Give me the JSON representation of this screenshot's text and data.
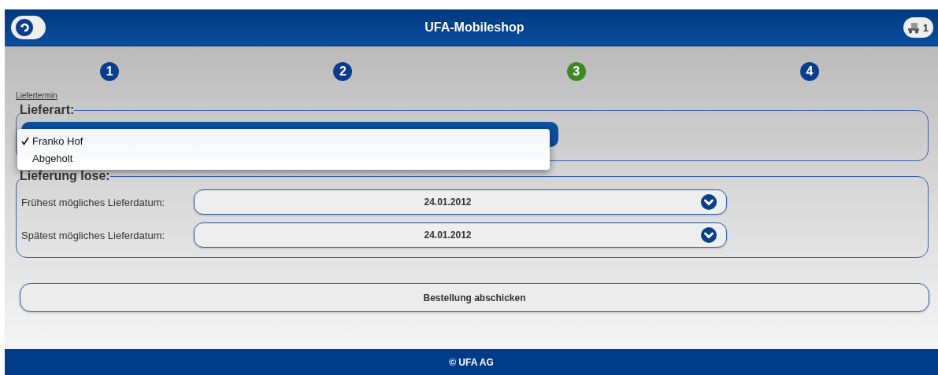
{
  "header": {
    "title": "UFA-Mobileshop",
    "cart_count": "1"
  },
  "steps": [
    {
      "label": "1",
      "selected": false
    },
    {
      "label": "2",
      "selected": false
    },
    {
      "label": "3",
      "selected": true
    },
    {
      "label": "4",
      "selected": false
    }
  ],
  "breadcrumb": "Liefertermin",
  "lieferart": {
    "legend": "Lieferart:",
    "menu": [
      {
        "label": "Franko Hof",
        "checked": true
      },
      {
        "label": "Abgeholt",
        "checked": false
      }
    ]
  },
  "lieferung": {
    "legend": "Lieferung lose:",
    "fields": [
      {
        "label": "Frühest mögliches Lieferdatum:",
        "value": "24.01.2012"
      },
      {
        "label": "Spätest mögliches Lieferdatum:",
        "value": "24.01.2012"
      }
    ]
  },
  "submit": "Bestellung abschicken",
  "footer": "© UFA AG"
}
